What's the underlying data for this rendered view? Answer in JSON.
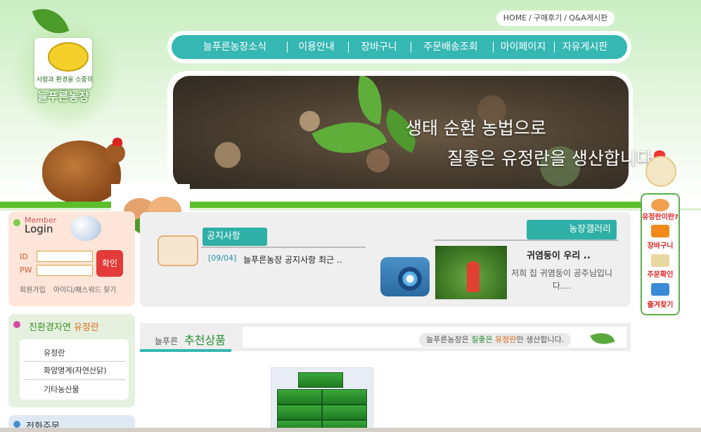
{
  "logo": {
    "name": "늘푸른농장",
    "slogan": "사람과 환경을 소중히"
  },
  "util_links": [
    "HOME",
    "구매후기",
    "Q&A게시판"
  ],
  "nav": [
    "늘푸른농장소식",
    "이용안내",
    "장바구니",
    "주문배송조회",
    "마이페이지",
    "자유게시판"
  ],
  "banner": {
    "line1": "생태 순환 농법으로",
    "line2": "질좋은 유정란을 생산합니다."
  },
  "login": {
    "title_small": "Member",
    "title": "Login",
    "id_label": "ID",
    "pw_label": "PW",
    "button": "확인",
    "join": "회원가입",
    "find": "아이디/패스워드 찾기",
    "id_value": "",
    "pw_value": ""
  },
  "category": {
    "title_a": "친환경자연",
    "title_b": "유정란",
    "items": [
      "유정란",
      "화양명계(자연산닭)",
      "기타농산물"
    ]
  },
  "tel": {
    "title": "전화주문"
  },
  "notice": {
    "tab": "공지사항",
    "date": "[09/04]",
    "text": "늘푸른농장 공지사항 최근 .."
  },
  "gallery": {
    "tab": "농장갤러리",
    "title": "귀염둥이 우리 ..",
    "desc": "저희 집 귀염둥이 공주님입니다...."
  },
  "recommend": {
    "label_small": "늘푸른",
    "label": "추천상품",
    "tag_a": "늘푸른농장은 ",
    "tag_b": "질좋은",
    "tag_c": "유정란",
    "tag_d": "만 생산합니다."
  },
  "quick_menu": [
    "유정란이란?",
    "장바구니",
    "주문확인",
    "즐겨찾기"
  ],
  "colors": {
    "teal": "#35b7b3",
    "green": "#5cbf2a",
    "login_bg": "#fde5da",
    "category_bg": "#e6f0de"
  }
}
